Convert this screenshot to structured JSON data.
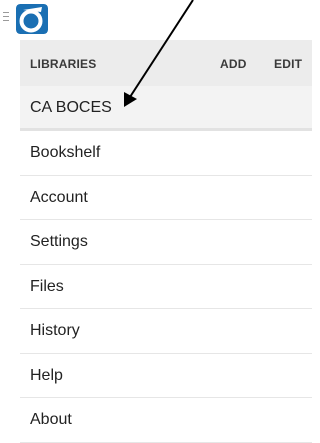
{
  "libraries_header": {
    "label": "LIBRARIES",
    "add_label": "ADD",
    "edit_label": "EDIT"
  },
  "current_library": {
    "name": "CA BOCES"
  },
  "menu": {
    "items": [
      {
        "label": "Bookshelf"
      },
      {
        "label": "Account"
      },
      {
        "label": "Settings"
      },
      {
        "label": "Files"
      },
      {
        "label": "History"
      },
      {
        "label": "Help"
      },
      {
        "label": "About"
      }
    ]
  },
  "colors": {
    "logo_blue": "#1a6fb3",
    "header_bg": "#ececec",
    "annotation_arrow": "#000000"
  },
  "icons": {
    "menu": "hamburger-icon",
    "logo": "app-logo-icon",
    "annotation": "arrow-annotation"
  }
}
